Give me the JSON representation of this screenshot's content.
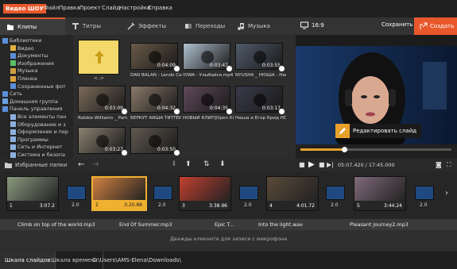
{
  "app": {
    "logo": "Видео ШОУ"
  },
  "menu": [
    "Файл",
    "Правка",
    "Проект",
    "Слайд",
    "Настройки",
    "Справка"
  ],
  "tabs": [
    "Клипы",
    "Титры",
    "Эффекты",
    "Переходы",
    "Музыка"
  ],
  "aspect": "16:9",
  "save_label": "Сохранить",
  "create_label": "Создать",
  "tree": [
    {
      "label": "Библиотеки",
      "depth": 0
    },
    {
      "label": "Видео",
      "depth": 1
    },
    {
      "label": "Документы",
      "depth": 1
    },
    {
      "label": "Изображения",
      "depth": 1
    },
    {
      "label": "Музыка",
      "depth": 1
    },
    {
      "label": "Пленка",
      "depth": 1
    },
    {
      "label": "Сохраненные фот",
      "depth": 1
    },
    {
      "label": "Сеть",
      "depth": 0
    },
    {
      "label": "Домашняя группа",
      "depth": 0
    },
    {
      "label": "Панель управления",
      "depth": 0
    },
    {
      "label": "Все элементы пан",
      "depth": 1
    },
    {
      "label": "Оборудование и з",
      "depth": 1
    },
    {
      "label": "Оформление и пер",
      "depth": 1
    },
    {
      "label": "Программы",
      "depth": 1
    },
    {
      "label": "Сеть и Интернет",
      "depth": 1
    },
    {
      "label": "Система и безопа",
      "depth": 1
    }
  ],
  "up_folder": "<..>",
  "clips": [
    {
      "dur": "0:04:09",
      "caption": "DAN BALAN - Lendo Cal..."
    },
    {
      "dur": "0:03:47",
      "caption": "IOWA - Улыбайся.mp4"
    },
    {
      "dur": "0:03:55",
      "caption": "NYUSHA _ НЮША - Наеди..."
    },
    {
      "dur": "0:03:09",
      "caption": "Robbie Williams _ Part..."
    },
    {
      "dur": "0:04:32",
      "caption": "БЕРКУТ АЙША ТИТТЕЙ но..."
    },
    {
      "dur": "0:04:35",
      "caption": "НОВЫЙ КЛИП]Open Kid..."
    },
    {
      "dur": "0:03:17",
      "caption": "Нюша и Егор Крид HD.mp4"
    },
    {
      "dur": "0:03:27",
      "caption": ""
    },
    {
      "dur": "0:03:50",
      "caption": ""
    }
  ],
  "edit_slide_label": "Редактировать слайд",
  "playback": {
    "time": "05:07.420 / 17:45.000",
    "progress": 0.29
  },
  "favorites_label": "Избранные папки",
  "slides": [
    {
      "num": "1",
      "dur": "3:07.2"
    },
    {
      "num": "2",
      "dur": "3:20.88"
    },
    {
      "num": "3",
      "dur": "3:38.96"
    },
    {
      "num": "4",
      "dur": "4:01.72"
    },
    {
      "num": "5",
      "dur": "3:44.24"
    }
  ],
  "transitions": [
    "2.0",
    "2.0",
    "2.0",
    "2.0",
    "2.0"
  ],
  "audio_tracks": [
    "Climb on top of the world.mp3",
    "End Of Summer.mp3",
    "Epic T...",
    "Into the light.wav",
    "Pleasant journey2.mp3"
  ],
  "voice_hint": "Дважды кликните для записи с микрофона",
  "status_tabs": [
    "Шкала слайдов",
    "Шкала времени"
  ],
  "path": "C:\\Users\\AMS-Elena\\Downloads\\",
  "colors": {
    "accent": "#e8582c",
    "highlight": "#f0b030"
  }
}
